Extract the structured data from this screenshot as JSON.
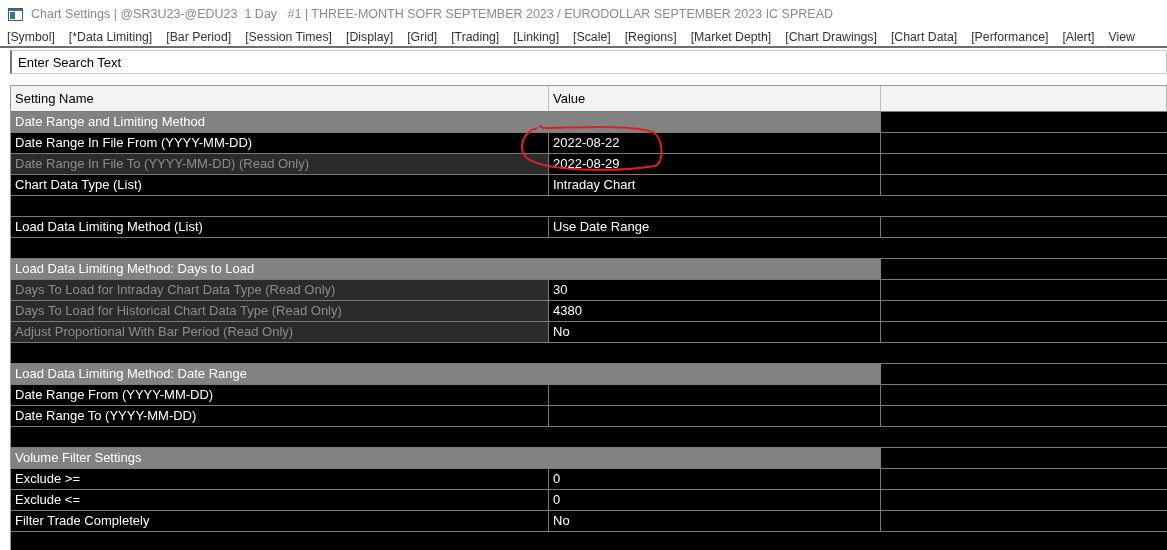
{
  "window": {
    "title": "Chart Settings | @SR3U23-@EDU23  1 Day   #1 | THREE-MONTH SOFR SEPTEMBER 2023 / EURODOLLAR SEPTEMBER 2023 IC SPREAD"
  },
  "menu": [
    "[Symbol]",
    "[*Data Limiting]",
    "[Bar Period]",
    "[Session Times]",
    "[Display]",
    "[Grid]",
    "[Trading]",
    "[Linking]",
    "[Scale]",
    "[Regions]",
    "[Market Depth]",
    "[Chart Drawings]",
    "[Chart Data]",
    "[Performance]",
    "[Alert]",
    "View"
  ],
  "search": {
    "placeholder": "Enter Search Text"
  },
  "table": {
    "columns": [
      "Setting Name",
      "Value"
    ],
    "rows": [
      {
        "kind": "section",
        "name": "Date Range and Limiting Method"
      },
      {
        "kind": "setting",
        "name": "Date Range In File From (YYYY-MM-DD)",
        "value": "2022-08-22",
        "read_only": false
      },
      {
        "kind": "setting",
        "name": "Date Range In File To (YYYY-MM-DD) (Read Only)",
        "value": "2022-08-29",
        "read_only": true
      },
      {
        "kind": "setting",
        "name": "Chart Data Type (List)",
        "value": "Intraday Chart",
        "read_only": false
      },
      {
        "kind": "blank"
      },
      {
        "kind": "setting",
        "name": "Load Data Limiting Method (List)",
        "value": "Use Date Range",
        "read_only": false
      },
      {
        "kind": "blank"
      },
      {
        "kind": "section",
        "name": "Load Data Limiting Method: Days to Load"
      },
      {
        "kind": "setting",
        "name": "Days To Load for Intraday Chart Data Type (Read Only)",
        "value": "30",
        "read_only": true
      },
      {
        "kind": "setting",
        "name": "Days To Load for Historical Chart Data Type (Read Only)",
        "value": "4380",
        "read_only": true
      },
      {
        "kind": "setting",
        "name": "Adjust Proportional With Bar Period (Read Only)",
        "value": "No",
        "read_only": true
      },
      {
        "kind": "blank"
      },
      {
        "kind": "section",
        "name": "Load Data Limiting Method: Date Range"
      },
      {
        "kind": "setting",
        "name": "Date Range From (YYYY-MM-DD)",
        "read_only": false
      },
      {
        "kind": "setting",
        "name": "Date Range To (YYYY-MM-DD)",
        "read_only": false
      },
      {
        "kind": "blank"
      },
      {
        "kind": "section",
        "name": "Volume Filter Settings"
      },
      {
        "kind": "setting",
        "name": "Exclude >=",
        "value": "0",
        "read_only": false
      },
      {
        "kind": "setting",
        "name": "Exclude <=",
        "value": "0",
        "read_only": false
      },
      {
        "kind": "setting",
        "name": "Filter Trade Completely",
        "value": "No",
        "read_only": false
      },
      {
        "kind": "blank"
      }
    ]
  }
}
